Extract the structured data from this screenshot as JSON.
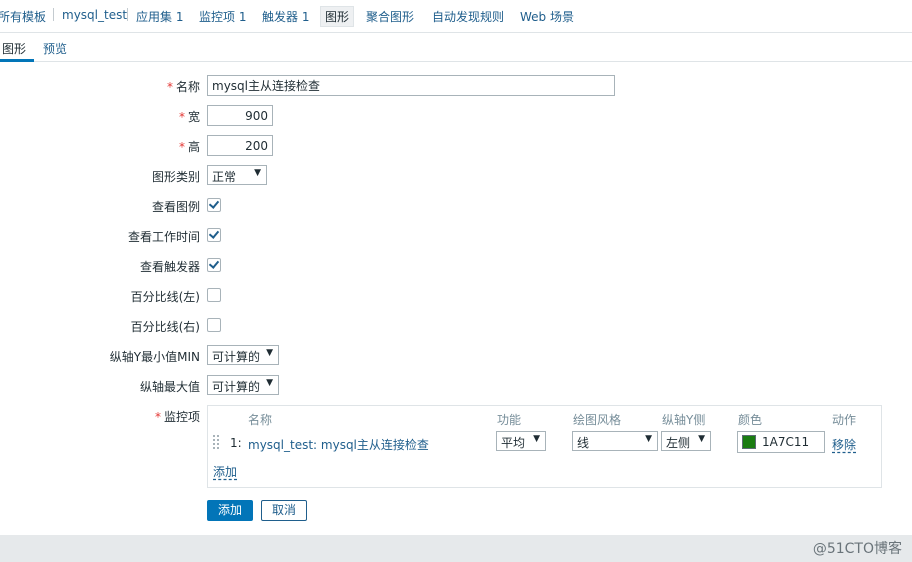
{
  "topnav": {
    "items": [
      {
        "label": "所有模板"
      },
      {
        "label": "mysql_test"
      },
      {
        "label": "应用集",
        "count": "1"
      },
      {
        "label": "监控项",
        "count": "1"
      },
      {
        "label": "触发器",
        "count": "1"
      },
      {
        "label": "图形"
      },
      {
        "label": "聚合图形"
      },
      {
        "label": "自动发现规则"
      },
      {
        "label": "Web 场景"
      }
    ]
  },
  "tabs": [
    {
      "label": "图形"
    },
    {
      "label": "预览"
    }
  ],
  "form": {
    "required_mark": "*",
    "name_label": "名称",
    "name_value": "mysql主从连接检查",
    "width_label": "宽",
    "width_value": "900",
    "height_label": "高",
    "height_value": "200",
    "graph_type_label": "图形类别",
    "graph_type_value": "正常",
    "show_legend_label": "查看图例",
    "show_legend_checked": true,
    "show_working_time_label": "查看工作时间",
    "show_working_time_checked": true,
    "show_triggers_label": "查看触发器",
    "show_triggers_checked": true,
    "percentile_left_label": "百分比线(左)",
    "percentile_left_checked": false,
    "percentile_right_label": "百分比线(右)",
    "percentile_right_checked": false,
    "ymin_label": "纵轴Y最小值MIN",
    "ymin_value": "可计算的",
    "ymax_label": "纵轴最大值",
    "ymax_value": "可计算的",
    "items_label": "监控项"
  },
  "items_table": {
    "headers": {
      "name": "名称",
      "function": "功能",
      "draw_style": "绘图风格",
      "y_axis_side": "纵轴Y侧",
      "color": "颜色",
      "action": "动作"
    },
    "rows": [
      {
        "index": "1:",
        "name": "mysql_test: mysql主从连接检查",
        "function": "平均",
        "draw_style": "线",
        "y_axis_side": "左侧",
        "color_hex": "1A7C11",
        "color": "#1A7C11",
        "remove_label": "移除"
      }
    ],
    "add_label": "添加"
  },
  "buttons": {
    "add": "添加",
    "cancel": "取消"
  },
  "watermark": "@51CTO博客"
}
